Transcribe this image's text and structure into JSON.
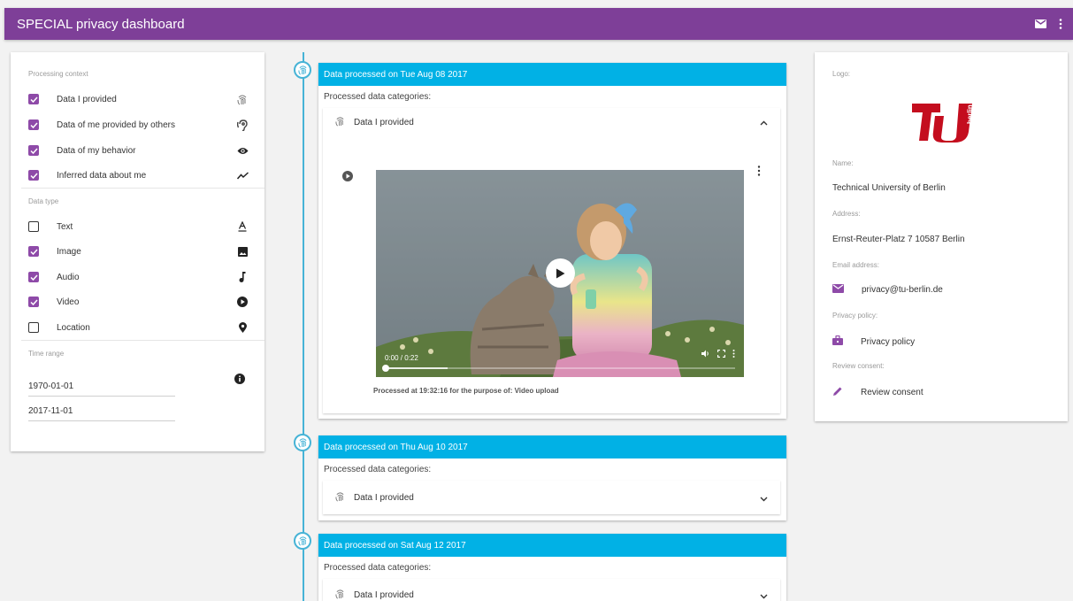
{
  "app": {
    "title": "SPECIAL privacy dashboard"
  },
  "appbar_icons": [
    "mail-icon",
    "more-vert-icon"
  ],
  "colors": {
    "primary": "#7e3f98",
    "accent": "#01b1e5",
    "checkbox": "#8e4aa8"
  },
  "filters": {
    "processing_context_label": "Processing context",
    "processing_context": [
      {
        "label": "Data I provided",
        "checked": true,
        "icon": "fingerprint-icon"
      },
      {
        "label": "Data of me provided by others",
        "checked": true,
        "icon": "hearing-icon"
      },
      {
        "label": "Data of my behavior",
        "checked": true,
        "icon": "eye-icon"
      },
      {
        "label": "Inferred data about me",
        "checked": true,
        "icon": "trending-icon"
      }
    ],
    "data_type_label": "Data type",
    "data_types": [
      {
        "label": "Text",
        "checked": false,
        "icon": "text-format-icon"
      },
      {
        "label": "Image",
        "checked": true,
        "icon": "image-icon"
      },
      {
        "label": "Audio",
        "checked": true,
        "icon": "music-note-icon"
      },
      {
        "label": "Video",
        "checked": true,
        "icon": "play-circle-icon"
      },
      {
        "label": "Location",
        "checked": false,
        "icon": "location-pin-icon"
      }
    ],
    "time_range_label": "Time range",
    "time_from": "1970-01-01",
    "time_to": "2017-11-01"
  },
  "timeline": [
    {
      "header": "Data processed on Tue Aug 08 2017",
      "subheader": "Processed data categories:",
      "category": "Data I provided",
      "expanded": true,
      "video_time": "0:00 / 0:22",
      "caption": "Processed at 19:32:16 for the purpose of: Video upload"
    },
    {
      "header": "Data processed on Thu Aug 10 2017",
      "subheader": "Processed data categories:",
      "category": "Data I provided",
      "expanded": false
    },
    {
      "header": "Data processed on Sat Aug 12 2017",
      "subheader": "Processed data categories:",
      "category": "Data I provided",
      "expanded": false
    }
  ],
  "controller": {
    "logo_label": "Logo:",
    "logo_text": "berlin",
    "name_label": "Name:",
    "name": "Technical University of Berlin",
    "address_label": "Address:",
    "address": "Ernst-Reuter-Platz 7 10587 Berlin",
    "email_label": "Email address:",
    "email": "privacy@tu-berlin.de",
    "policy_label": "Privacy policy:",
    "policy": "Privacy policy",
    "review_label": "Review consent:",
    "review": "Review consent"
  }
}
